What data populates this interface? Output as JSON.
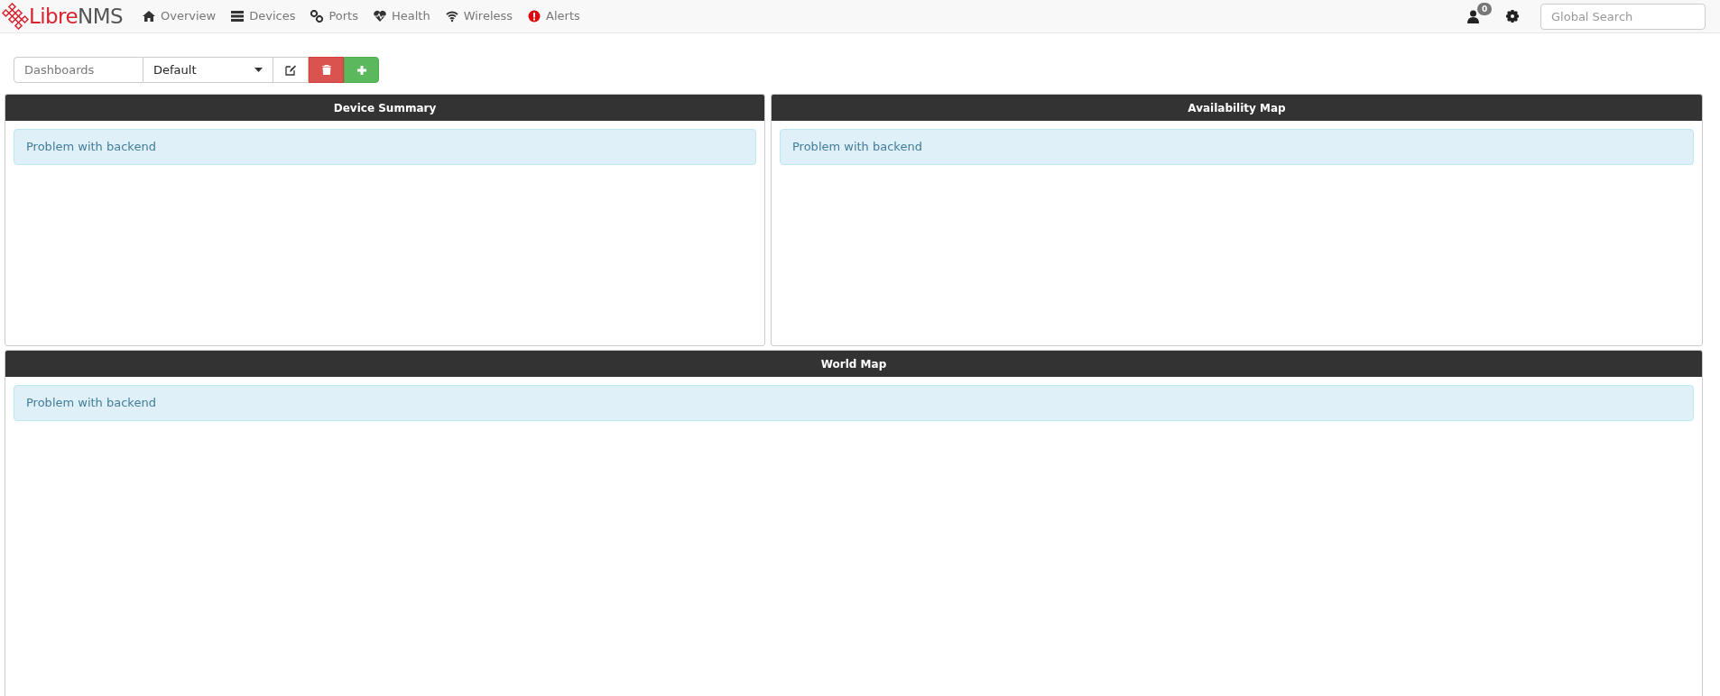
{
  "navbar": {
    "logo": {
      "part_1": "Libre",
      "part_2": "NMS"
    },
    "menu": [
      {
        "label": "Overview"
      },
      {
        "label": "Devices"
      },
      {
        "label": "Ports"
      },
      {
        "label": "Health"
      },
      {
        "label": "Wireless"
      },
      {
        "label": "Alerts"
      }
    ],
    "notification_count": "0",
    "search": {
      "placeholder": "Global Search"
    }
  },
  "toolbar": {
    "label": "Dashboards",
    "dashboard_select": {
      "value": "Default"
    }
  },
  "widgets": [
    {
      "title": "Device Summary",
      "message": "Problem with backend"
    },
    {
      "title": "Availability Map",
      "message": "Problem with backend"
    },
    {
      "title": "World Map",
      "message": "Problem with backend"
    }
  ]
}
